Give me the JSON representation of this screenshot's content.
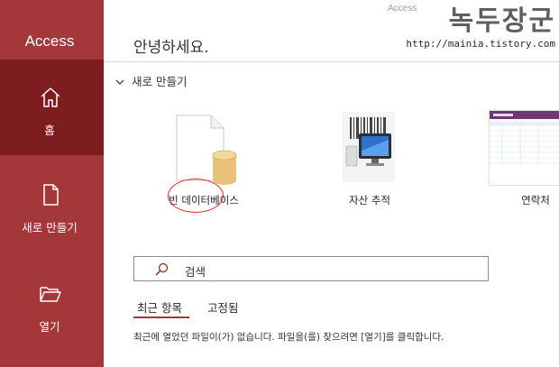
{
  "app": {
    "brand": "Access",
    "window_title": "Access"
  },
  "watermark": {
    "title": "녹두장군",
    "url": "http://mainia.tistory.com"
  },
  "nav": [
    {
      "label": "홈",
      "icon": "home-icon"
    },
    {
      "label": "새로 만들기",
      "icon": "new-document-icon"
    },
    {
      "label": "열기",
      "icon": "folder-open-icon"
    }
  ],
  "main": {
    "greeting": "안녕하세요.",
    "new_section": "새로 만들기",
    "templates": [
      {
        "label": "빈 데이터베이스",
        "icon": "blank-database-icon"
      },
      {
        "label": "자산 추적",
        "icon": "asset-tracking-icon"
      },
      {
        "label": "연락처",
        "icon": "contacts-template-icon"
      }
    ],
    "search_placeholder": "검색",
    "tabs": [
      "최근 항목",
      "고정됨"
    ],
    "recent_empty": "최근에 열었던 파일이(가) 없습니다. 파일을(를) 찾으려면 [열기]를 클릭합니다."
  },
  "colors": {
    "sidebar": "#a4373a",
    "sidebar_active": "#7d1d1f",
    "annotation": "#e0262b"
  }
}
